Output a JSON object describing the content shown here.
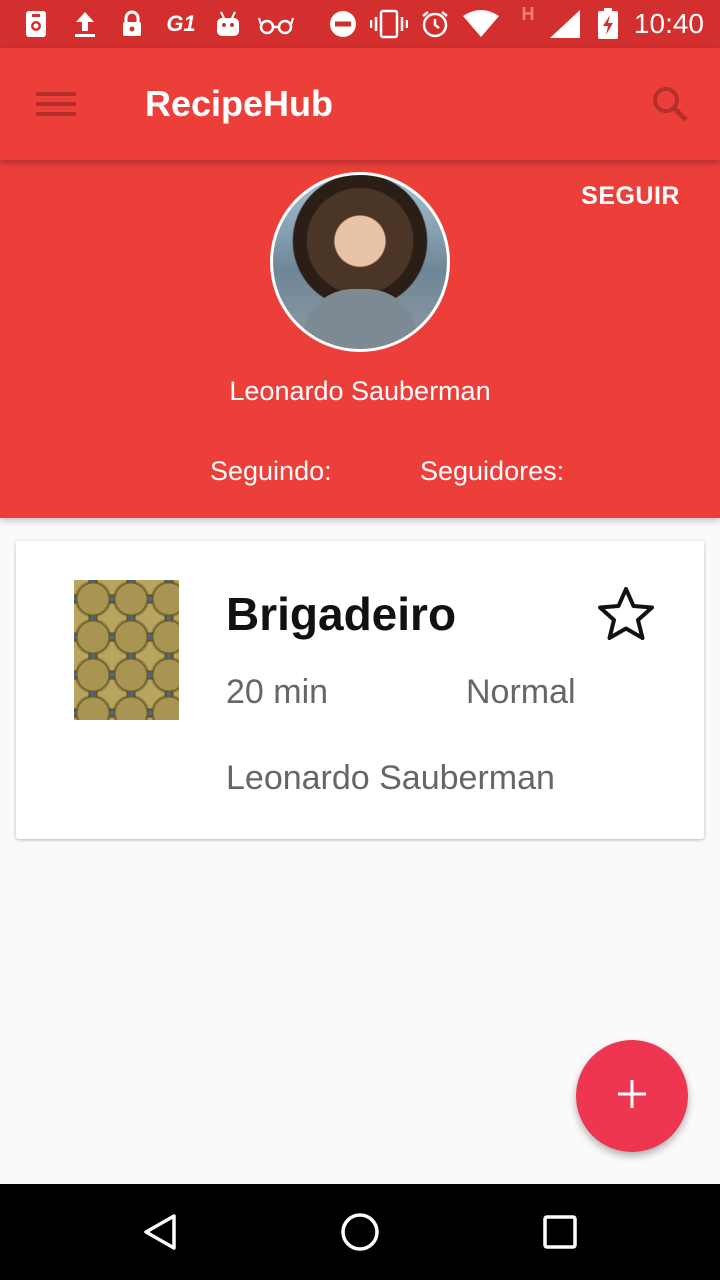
{
  "status_bar": {
    "time": "10:40",
    "icons": [
      "camera-notification-icon",
      "upload-icon",
      "lock-icon",
      "g1-icon",
      "android-icon",
      "glasses-icon",
      "do-not-disturb-icon",
      "vibrate-icon",
      "alarm-icon",
      "wifi-icon",
      "network-h-icon",
      "signal-icon",
      "battery-charging-icon"
    ],
    "g1_label": "G1",
    "network_label": "H"
  },
  "toolbar": {
    "title": "RecipeHub",
    "menu_icon": "hamburger-icon",
    "search_icon": "search-icon"
  },
  "profile": {
    "follow_label": "SEGUIR",
    "name": "Leonardo Sauberman",
    "following_label": "Seguindo:",
    "followers_label": "Seguidores:"
  },
  "recipes": [
    {
      "title": "Brigadeiro",
      "time": "20 min",
      "difficulty": "Normal",
      "author": "Leonardo Sauberman",
      "favorite": false
    }
  ],
  "fab": {
    "icon": "plus-icon"
  },
  "nav_bar": {
    "icons": [
      "back-icon",
      "home-icon",
      "recents-icon"
    ]
  },
  "colors": {
    "primary": "#ec3f3a",
    "status_bar": "#d32f2f",
    "accent": "#ef3651",
    "background": "#fafafa"
  }
}
